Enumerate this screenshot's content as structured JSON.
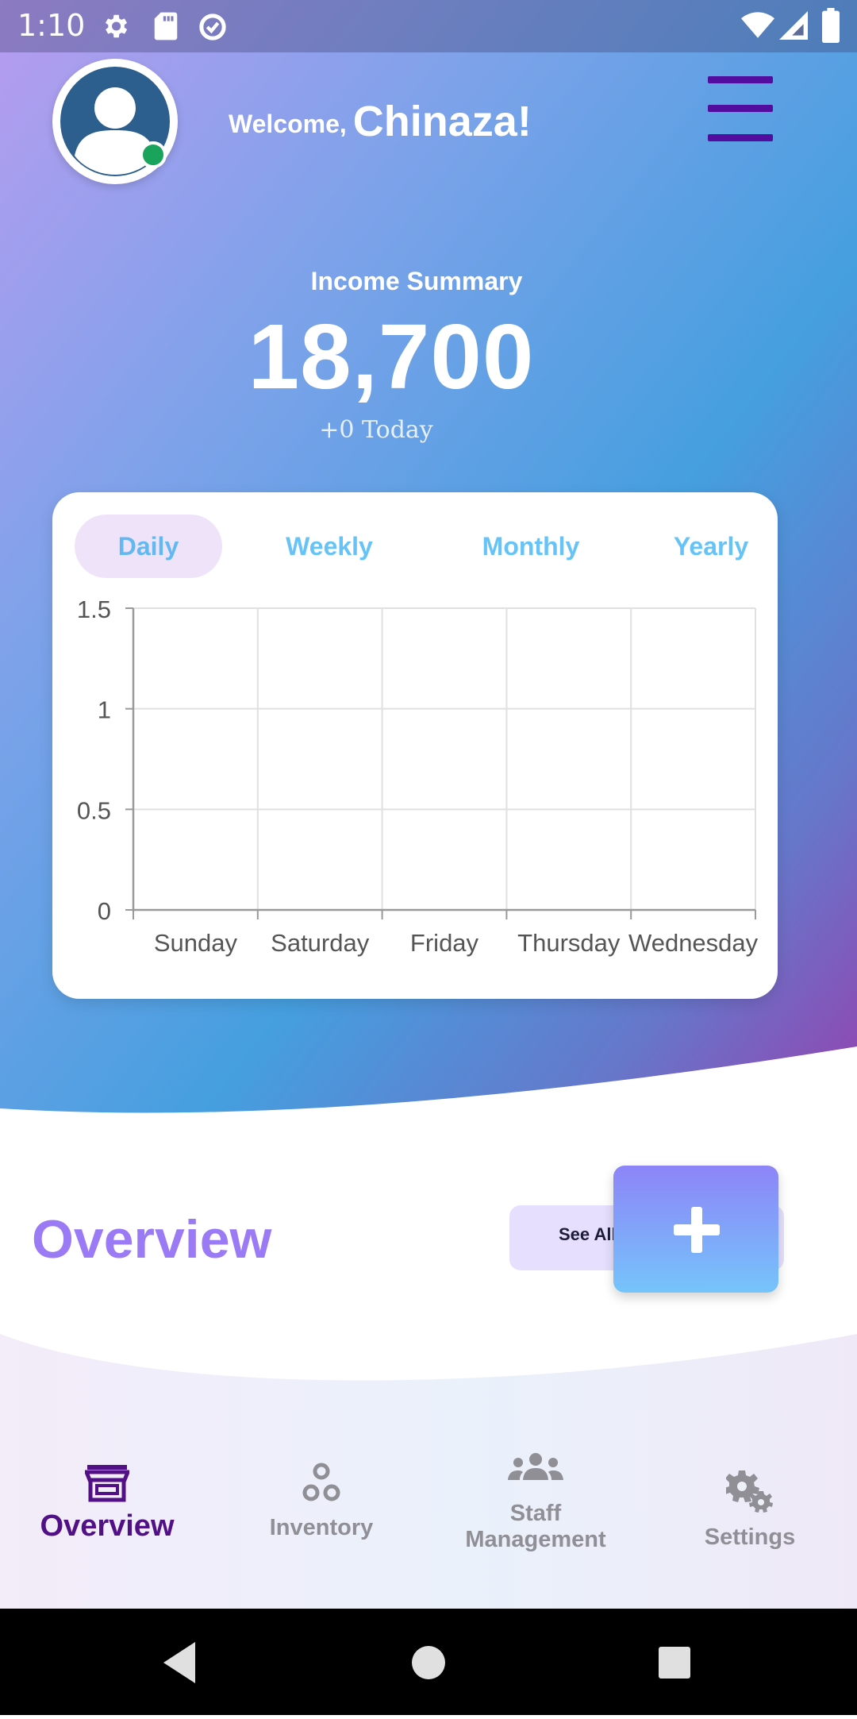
{
  "status_bar": {
    "time": "1:10",
    "icons": [
      "gear-icon",
      "sd-card-icon",
      "data-saver-icon",
      "wifi-icon",
      "signal-icon",
      "battery-icon"
    ]
  },
  "header": {
    "welcome_prefix": "Welcome,",
    "user_name": "Chinaza!",
    "avatar_icon": "user-avatar-icon",
    "menu_icon": "hamburger-menu-icon",
    "online_status_color": "#1aa35a",
    "menu_color": "#520d9f"
  },
  "income_summary": {
    "label": "Income Summary",
    "value": "18,700",
    "today": "+0 Today"
  },
  "chart_tabs": {
    "selected": "Daily",
    "tabs": [
      {
        "label": "Daily"
      },
      {
        "label": "Weekly"
      },
      {
        "label": "Monthly"
      },
      {
        "label": "Yearly"
      }
    ]
  },
  "chart_data": {
    "type": "bar",
    "categories": [
      "Sunday",
      "Saturday",
      "Friday",
      "Thursday",
      "Wednesday"
    ],
    "values": [
      0,
      0,
      0,
      0,
      0
    ],
    "y_ticks": [
      "0",
      "0.5",
      "1",
      "1.5"
    ],
    "ylim": [
      0,
      1.5
    ],
    "grid": true
  },
  "overview": {
    "title": "Overview",
    "see_all_label": "See All",
    "fab_icon": "plus-icon"
  },
  "bottom_nav": {
    "selected": "Overview",
    "items": [
      {
        "label": "Overview",
        "icon": "store-icon"
      },
      {
        "label": "Inventory",
        "icon": "inventory-icon"
      },
      {
        "label": "Staff\nManagement",
        "icon": "people-icon"
      },
      {
        "label": "Settings",
        "icon": "gears-icon"
      }
    ]
  },
  "system_nav": {
    "icons": [
      "back-icon",
      "home-icon",
      "recents-icon"
    ]
  },
  "colors": {
    "accent_purple": "#9b7af5",
    "tab_blue": "#66c3f7",
    "nav_active": "#521087",
    "nav_inactive": "#8f8f95"
  }
}
